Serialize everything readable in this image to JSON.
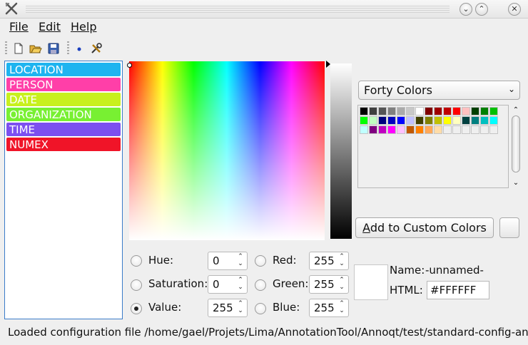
{
  "menu": {
    "file": "File",
    "edit": "Edit",
    "help": "Help"
  },
  "entities": [
    {
      "label": "LOCATION",
      "color": "#1eb4f0"
    },
    {
      "label": "PERSON",
      "color": "#ff3fa8"
    },
    {
      "label": "DATE",
      "color": "#c8f01e"
    },
    {
      "label": "ORGANIZATION",
      "color": "#78f032"
    },
    {
      "label": "TIME",
      "color": "#7c4ff0"
    },
    {
      "label": "NUMEX",
      "color": "#f01428"
    }
  ],
  "color_dialog": {
    "hue_label": "Hue:",
    "saturation_label": "Saturation:",
    "value_label": "Value:",
    "red_label": "Red:",
    "green_label": "Green:",
    "blue_label": "Blue:",
    "hue": "0",
    "saturation": "0",
    "value": "255",
    "red": "255",
    "green": "255",
    "blue": "255",
    "name_label": "Name:",
    "name_value": "-unnamed-",
    "html_label": "HTML:",
    "html_value": "#FFFFFF",
    "palette_name": "Forty Colors",
    "add_custom_prefix": "A",
    "add_custom_rest": "dd to Custom Colors",
    "swatches": [
      "#000000",
      "#3f3f3f",
      "#555555",
      "#7f7f7f",
      "#aaaaaa",
      "#c8c8c8",
      "#ffffff",
      "#800000",
      "#9f0000",
      "#c00000",
      "#ff0000",
      "#ffc0c0",
      "#004000",
      "#008000",
      "#00c000",
      "#00ff00",
      "#c0ffc0",
      "#000080",
      "#0000c0",
      "#0000ff",
      "#c0c0ff",
      "#404000",
      "#808000",
      "#c0c000",
      "#ffff00",
      "#ffffc0",
      "#004040",
      "#008080",
      "#00c0c0",
      "#00ffff",
      "#c0ffff",
      "#800080",
      "#c000c0",
      "#ff00ff",
      "#ffc0ff",
      "#c05800",
      "#ff8000",
      "#ffa858",
      "#ffdca8"
    ]
  },
  "status": "Loaded configuration file /home/gael/Projets/Lima/AnnotationTool/Annoqt/test/standard-config-annotation.xml"
}
